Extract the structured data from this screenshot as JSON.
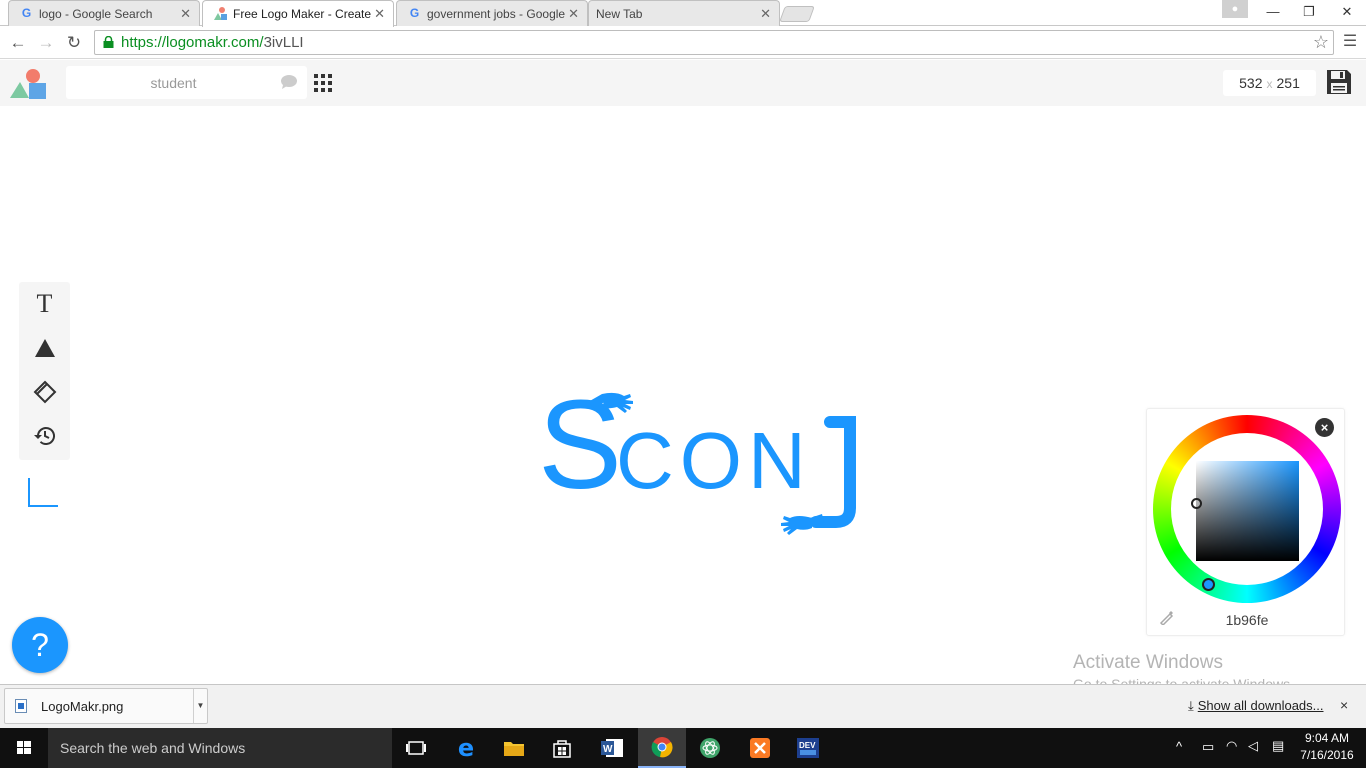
{
  "browser": {
    "tabs": [
      {
        "title": "logo - Google Search",
        "favicon": "google-icon",
        "active": false
      },
      {
        "title": "Free Logo Maker - Create",
        "favicon": "logomakr-icon",
        "active": true
      },
      {
        "title": "government jobs - Google",
        "favicon": "google-icon",
        "active": false
      },
      {
        "title": "New Tab",
        "favicon": "",
        "active": false
      }
    ],
    "url_host": "https://logomakr.com/",
    "url_path": "3ivLLI"
  },
  "app": {
    "search_placeholder": "student",
    "dims_width": "532",
    "dims_x": "x",
    "dims_height": "251",
    "logo_text_s": "S",
    "logo_text_rest": "CON",
    "logo_text_j": "J",
    "accent_color": "#1b96fe"
  },
  "color_picker": {
    "hex": "1b96fe",
    "close_label": "×"
  },
  "help": {
    "label": "?"
  },
  "watermark": {
    "title": "Activate Windows",
    "subtitle": "Go to Settings to activate Windows."
  },
  "downloads": {
    "file_name": "LogoMakr.png",
    "show_all": "Show all downloads...",
    "close_label": "×"
  },
  "taskbar": {
    "search_placeholder": "Search the web and Windows",
    "time": "9:04 AM",
    "date": "7/16/2016"
  }
}
